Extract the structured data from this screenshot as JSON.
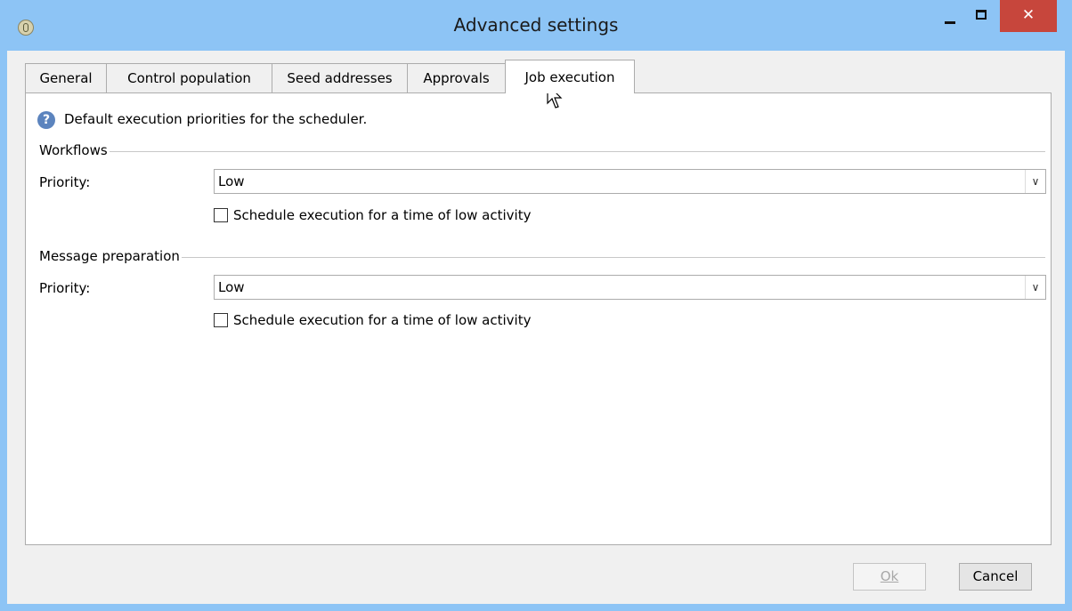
{
  "window": {
    "title": "Advanced settings",
    "close_glyph": "✕"
  },
  "tabs": [
    {
      "label": "General"
    },
    {
      "label": "Control population"
    },
    {
      "label": "Seed addresses"
    },
    {
      "label": "Approvals"
    },
    {
      "label": "Job execution",
      "active": true
    }
  ],
  "info": {
    "icon_glyph": "?",
    "text": "Default execution priorities for the scheduler."
  },
  "workflows": {
    "group_label": "Workflows",
    "priority_label": "Priority:",
    "priority_value": "Low",
    "schedule_label": "Schedule execution for a time of low activity",
    "schedule_checked": false
  },
  "message_preparation": {
    "group_label": "Message preparation",
    "priority_label": "Priority:",
    "priority_value": "Low",
    "schedule_label": "Schedule execution for a time of low activity",
    "schedule_checked": false
  },
  "dropdown_glyph": "∨",
  "buttons": {
    "ok_label": "Ok",
    "cancel_label": "Cancel"
  },
  "colors": {
    "title_bar": "#8dc4f5",
    "close_button": "#c7463c",
    "info_icon": "#5c84be"
  }
}
